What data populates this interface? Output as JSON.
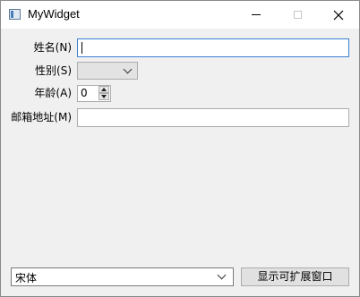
{
  "window": {
    "title": "MyWidget",
    "minimize_icon": "minimize-icon",
    "maximize_icon": "maximize-icon",
    "close_icon": "close-icon"
  },
  "form": {
    "name_label": "姓名(N)",
    "name_value": "",
    "gender_label": "性别(S)",
    "gender_value": "",
    "age_label": "年龄(A)",
    "age_value": "0",
    "email_label": "邮箱地址(M)",
    "email_value": ""
  },
  "bottom": {
    "font_value": "宋体",
    "expand_button": "显示可扩展窗口"
  }
}
